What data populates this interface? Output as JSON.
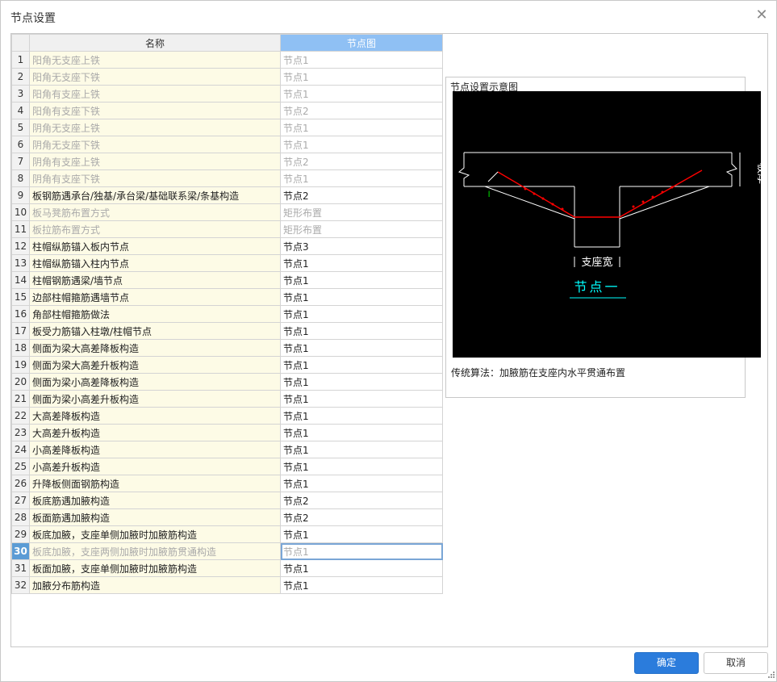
{
  "window": {
    "title": "节点设置"
  },
  "grid": {
    "headers": [
      "名称",
      "节点图"
    ],
    "rows": [
      {
        "num": "1",
        "name": "阳角无支座上铁",
        "value": "节点1",
        "disabled": true
      },
      {
        "num": "2",
        "name": "阳角无支座下铁",
        "value": "节点1",
        "disabled": true
      },
      {
        "num": "3",
        "name": "阳角有支座上铁",
        "value": "节点1",
        "disabled": true
      },
      {
        "num": "4",
        "name": "阳角有支座下铁",
        "value": "节点2",
        "disabled": true
      },
      {
        "num": "5",
        "name": "阴角无支座上铁",
        "value": "节点1",
        "disabled": true
      },
      {
        "num": "6",
        "name": "阴角无支座下铁",
        "value": "节点1",
        "disabled": true
      },
      {
        "num": "7",
        "name": "阴角有支座上铁",
        "value": "节点2",
        "disabled": true
      },
      {
        "num": "8",
        "name": "阴角有支座下铁",
        "value": "节点1",
        "disabled": true
      },
      {
        "num": "9",
        "name": "板钢筋遇承台/独基/承台梁/基础联系梁/条基构造",
        "value": "节点2",
        "disabled": false
      },
      {
        "num": "10",
        "name": "板马凳筋布置方式",
        "value": "矩形布置",
        "disabled": true
      },
      {
        "num": "11",
        "name": "板拉筋布置方式",
        "value": "矩形布置",
        "disabled": true
      },
      {
        "num": "12",
        "name": "柱帽纵筋锚入板内节点",
        "value": "节点3",
        "disabled": false
      },
      {
        "num": "13",
        "name": "柱帽纵筋锚入柱内节点",
        "value": "节点1",
        "disabled": false
      },
      {
        "num": "14",
        "name": "柱帽钢筋遇梁/墙节点",
        "value": "节点1",
        "disabled": false
      },
      {
        "num": "15",
        "name": "边部柱帽箍筋遇墙节点",
        "value": "节点1",
        "disabled": false
      },
      {
        "num": "16",
        "name": "角部柱帽箍筋做法",
        "value": "节点1",
        "disabled": false
      },
      {
        "num": "17",
        "name": "板受力筋锚入柱墩/柱帽节点",
        "value": "节点1",
        "disabled": false
      },
      {
        "num": "18",
        "name": "侧面为梁大高差降板构造",
        "value": "节点1",
        "disabled": false
      },
      {
        "num": "19",
        "name": "侧面为梁大高差升板构造",
        "value": "节点1",
        "disabled": false
      },
      {
        "num": "20",
        "name": "侧面为梁小高差降板构造",
        "value": "节点1",
        "disabled": false
      },
      {
        "num": "21",
        "name": "侧面为梁小高差升板构造",
        "value": "节点1",
        "disabled": false
      },
      {
        "num": "22",
        "name": "大高差降板构造",
        "value": "节点1",
        "disabled": false
      },
      {
        "num": "23",
        "name": "大高差升板构造",
        "value": "节点1",
        "disabled": false
      },
      {
        "num": "24",
        "name": "小高差降板构造",
        "value": "节点1",
        "disabled": false
      },
      {
        "num": "25",
        "name": "小高差升板构造",
        "value": "节点1",
        "disabled": false
      },
      {
        "num": "26",
        "name": "升降板侧面钢筋构造",
        "value": "节点1",
        "disabled": false
      },
      {
        "num": "27",
        "name": "板底筋遇加腋构造",
        "value": "节点2",
        "disabled": false
      },
      {
        "num": "28",
        "name": "板面筋遇加腋构造",
        "value": "节点2",
        "disabled": false
      },
      {
        "num": "29",
        "name": "板底加腋，支座单侧加腋时加腋筋构造",
        "value": "节点1",
        "disabled": false
      },
      {
        "num": "30",
        "name": "板底加腋，支座两侧加腋时加腋筋贯通构造",
        "value": "节点1",
        "disabled": true,
        "selected": true
      },
      {
        "num": "31",
        "name": "板面加腋，支座单侧加腋时加腋筋构造",
        "value": "节点1",
        "disabled": false
      },
      {
        "num": "32",
        "name": "加腋分布筋构造",
        "value": "节点1",
        "disabled": false
      }
    ]
  },
  "preview": {
    "title": "节点设置示意图",
    "diagram": {
      "thickness_label": "板厚",
      "support_width_label": "支座宽",
      "node_label": "节点一",
      "dimension_mark": "l"
    },
    "description": "传统算法：加腋筋在支座内水平贯通布置"
  },
  "buttons": {
    "ok": "确定",
    "cancel": "取消"
  },
  "colors": {
    "accent": "#2b7cdc",
    "header_selected": "#8fc0f4",
    "name_bg": "#fdfbe6",
    "rebar": "#ff0000",
    "label_cyan": "#00ffff",
    "dim_green": "#00ff00"
  }
}
